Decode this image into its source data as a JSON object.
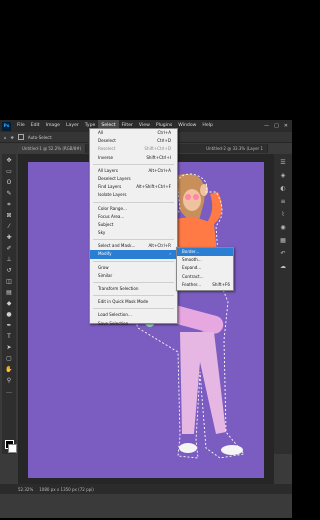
{
  "menubar": {
    "logo": "Ps",
    "items": [
      "File",
      "Edit",
      "Image",
      "Layer",
      "Type",
      "Select",
      "Filter",
      "View",
      "Plugins",
      "Window",
      "Help"
    ],
    "window_controls": [
      "—",
      "□",
      "✕"
    ]
  },
  "optionsbar": {
    "auto_select_label": "Auto-Select:"
  },
  "tabs": {
    "left": "Untitled-1 @ 52.2% (RGB/8#)",
    "right": "Untitled-2 @ 33.3% (Layer 1"
  },
  "select_menu": {
    "items": [
      {
        "label": "All",
        "shortcut": "Ctrl+A",
        "disabled": false
      },
      {
        "label": "Deselect",
        "shortcut": "Ctrl+D",
        "disabled": false
      },
      {
        "label": "Reselect",
        "shortcut": "Shift+Ctrl+D",
        "disabled": true
      },
      {
        "label": "Inverse",
        "shortcut": "Shift+Ctrl+I",
        "disabled": false
      },
      {
        "sep": true
      },
      {
        "label": "All Layers",
        "shortcut": "Alt+Ctrl+A",
        "disabled": false
      },
      {
        "label": "Deselect Layers",
        "shortcut": "",
        "disabled": false
      },
      {
        "label": "Find Layers",
        "shortcut": "Alt+Shift+Ctrl+F",
        "disabled": false
      },
      {
        "label": "Isolate Layers",
        "shortcut": "",
        "disabled": false
      },
      {
        "sep": true
      },
      {
        "label": "Color Range...",
        "shortcut": "",
        "disabled": false
      },
      {
        "label": "Focus Area...",
        "shortcut": "",
        "disabled": false
      },
      {
        "label": "Subject",
        "shortcut": "",
        "disabled": false
      },
      {
        "label": "Sky",
        "shortcut": "",
        "disabled": false
      },
      {
        "sep": true
      },
      {
        "label": "Select and Mask...",
        "shortcut": "Alt+Ctrl+R",
        "disabled": false
      },
      {
        "label": "Modify",
        "shortcut": "›",
        "disabled": false,
        "highlight": true
      },
      {
        "sep": true
      },
      {
        "label": "Grow",
        "shortcut": "",
        "disabled": false
      },
      {
        "label": "Similar",
        "shortcut": "",
        "disabled": false
      },
      {
        "sep": true
      },
      {
        "label": "Transform Selection",
        "shortcut": "",
        "disabled": false
      },
      {
        "sep": true
      },
      {
        "label": "Edit in Quick Mask Mode",
        "shortcut": "",
        "disabled": false
      },
      {
        "sep": true
      },
      {
        "label": "Load Selection...",
        "shortcut": "",
        "disabled": false
      },
      {
        "label": "Save Selection...",
        "shortcut": "",
        "disabled": false
      }
    ]
  },
  "modify_submenu": {
    "items": [
      {
        "label": "Border...",
        "shortcut": "",
        "highlight": true
      },
      {
        "label": "Smooth...",
        "shortcut": ""
      },
      {
        "label": "Expand...",
        "shortcut": ""
      },
      {
        "label": "Contract...",
        "shortcut": ""
      },
      {
        "label": "Feather...",
        "shortcut": "Shift+F6"
      }
    ]
  },
  "statusbar": {
    "zoom": "52.32%",
    "doc_info": "1080 px x 1350 px (72 ppi)"
  },
  "colors": {
    "canvas_bg": "#7b5cc0",
    "menu_highlight": "#2a7fd4"
  }
}
